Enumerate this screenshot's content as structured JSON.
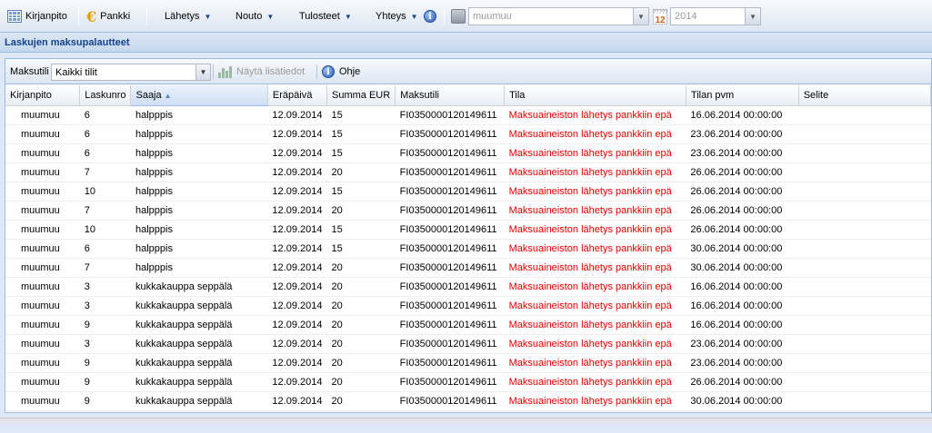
{
  "toolbar": {
    "kirjanpito": "Kirjanpito",
    "pankki": "Pankki",
    "lahetys": "Lähetys",
    "nouto": "Nouto",
    "tulosteet": "Tulosteet",
    "yhteys": "Yhteys",
    "company_value": "muumuu",
    "cal_top": "?????",
    "cal_num": "12",
    "year_value": "2014"
  },
  "panel": {
    "title": "Laskujen maksupalautteet"
  },
  "gridtoolbar": {
    "maksutili_label": "Maksutili",
    "maksutili_value": "Kaikki tilit",
    "nayta_label": "Näytä lisätiedot",
    "ohje_label": "Ohje"
  },
  "columns": {
    "kirjanpito": "Kirjanpito",
    "laskunro": "Laskunro",
    "saaja": "Saaja",
    "erapaiva": "Eräpäivä",
    "summa": "Summa EUR",
    "maksutili": "Maksutili",
    "tila": "Tila",
    "tilan_pvm": "Tilan pvm",
    "selite": "Selite"
  },
  "rows": [
    [
      "muumuu",
      "6",
      "halpppis",
      "12.09.2014",
      "15",
      "FI0350000120149611",
      "Maksuaineiston lähetys pankkiin epä",
      "16.06.2014 00:00:00",
      ""
    ],
    [
      "muumuu",
      "6",
      "halpppis",
      "12.09.2014",
      "15",
      "FI0350000120149611",
      "Maksuaineiston lähetys pankkiin epä",
      "23.06.2014 00:00:00",
      ""
    ],
    [
      "muumuu",
      "6",
      "halpppis",
      "12.09.2014",
      "15",
      "FI0350000120149611",
      "Maksuaineiston lähetys pankkiin epä",
      "23.06.2014 00:00:00",
      ""
    ],
    [
      "muumuu",
      "7",
      "halpppis",
      "12.09.2014",
      "20",
      "FI0350000120149611",
      "Maksuaineiston lähetys pankkiin epä",
      "26.06.2014 00:00:00",
      ""
    ],
    [
      "muumuu",
      "10",
      "halpppis",
      "12.09.2014",
      "15",
      "FI0350000120149611",
      "Maksuaineiston lähetys pankkiin epä",
      "26.06.2014 00:00:00",
      ""
    ],
    [
      "muumuu",
      "7",
      "halpppis",
      "12.09.2014",
      "20",
      "FI0350000120149611",
      "Maksuaineiston lähetys pankkiin epä",
      "26.06.2014 00:00:00",
      ""
    ],
    [
      "muumuu",
      "10",
      "halpppis",
      "12.09.2014",
      "15",
      "FI0350000120149611",
      "Maksuaineiston lähetys pankkiin epä",
      "26.06.2014 00:00:00",
      ""
    ],
    [
      "muumuu",
      "6",
      "halpppis",
      "12.09.2014",
      "15",
      "FI0350000120149611",
      "Maksuaineiston lähetys pankkiin epä",
      "30.06.2014 00:00:00",
      ""
    ],
    [
      "muumuu",
      "7",
      "halpppis",
      "12.09.2014",
      "20",
      "FI0350000120149611",
      "Maksuaineiston lähetys pankkiin epä",
      "30.06.2014 00:00:00",
      ""
    ],
    [
      "muumuu",
      "3",
      "kukkakauppa seppälä",
      "12.09.2014",
      "20",
      "FI0350000120149611",
      "Maksuaineiston lähetys pankkiin epä",
      "16.06.2014 00:00:00",
      ""
    ],
    [
      "muumuu",
      "3",
      "kukkakauppa seppälä",
      "12.09.2014",
      "20",
      "FI0350000120149611",
      "Maksuaineiston lähetys pankkiin epä",
      "16.06.2014 00:00:00",
      ""
    ],
    [
      "muumuu",
      "9",
      "kukkakauppa seppälä",
      "12.09.2014",
      "20",
      "FI0350000120149611",
      "Maksuaineiston lähetys pankkiin epä",
      "16.06.2014 00:00:00",
      ""
    ],
    [
      "muumuu",
      "3",
      "kukkakauppa seppälä",
      "12.09.2014",
      "20",
      "FI0350000120149611",
      "Maksuaineiston lähetys pankkiin epä",
      "23.06.2014 00:00:00",
      ""
    ],
    [
      "muumuu",
      "9",
      "kukkakauppa seppälä",
      "12.09.2014",
      "20",
      "FI0350000120149611",
      "Maksuaineiston lähetys pankkiin epä",
      "23.06.2014 00:00:00",
      ""
    ],
    [
      "muumuu",
      "9",
      "kukkakauppa seppälä",
      "12.09.2014",
      "20",
      "FI0350000120149611",
      "Maksuaineiston lähetys pankkiin epä",
      "26.06.2014 00:00:00",
      ""
    ],
    [
      "muumuu",
      "9",
      "kukkakauppa seppälä",
      "12.09.2014",
      "20",
      "FI0350000120149611",
      "Maksuaineiston lähetys pankkiin epä",
      "30.06.2014 00:00:00",
      ""
    ]
  ],
  "colors": {
    "status_error": "#e00000",
    "header_text": "#15428b",
    "border": "#99bbe8"
  }
}
